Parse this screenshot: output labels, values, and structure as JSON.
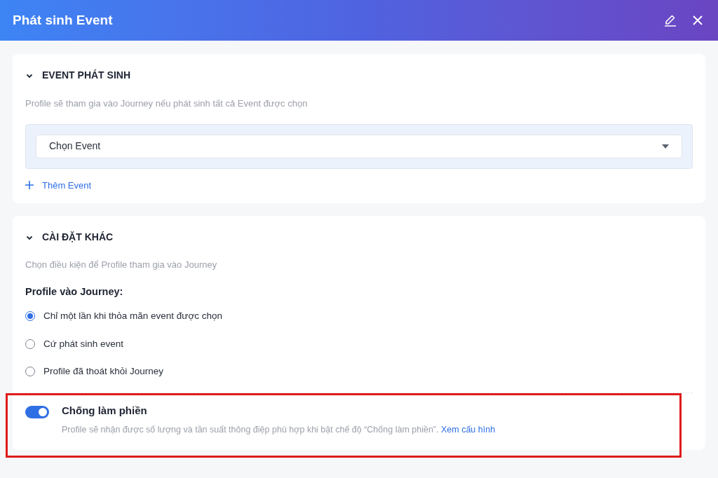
{
  "window": {
    "title": "Phát sinh Event"
  },
  "event_section": {
    "title": "EVENT PHÁT SINH",
    "expanded": true,
    "description": "Profile sẽ tham gia vào Journey nếu phát sinh tất cả Event được chọn",
    "select": {
      "placeholder": "Chọn Event"
    },
    "add_button": "Thêm Event"
  },
  "other_section": {
    "title": "CÀI ĐẶT KHÁC",
    "expanded": true,
    "description": "Chọn điều kiện để Profile tham gia vào Journey",
    "group_label": "Profile vào Journey:",
    "options": [
      {
        "label": "Chỉ một lần khi thỏa mãn event được chọn",
        "selected": true
      },
      {
        "label": "Cứ phát sinh event",
        "selected": false
      },
      {
        "label": "Profile đã thoát khỏi Journey",
        "selected": false
      }
    ],
    "toggle": {
      "label": "Chống làm phiền",
      "on": true,
      "highlighted": true,
      "description": "Profile sẽ nhận được số lượng và tần suất thông điệp phù hợp khi bật chế độ “Chống làm phiền”.",
      "link": "Xem cấu hình"
    }
  }
}
